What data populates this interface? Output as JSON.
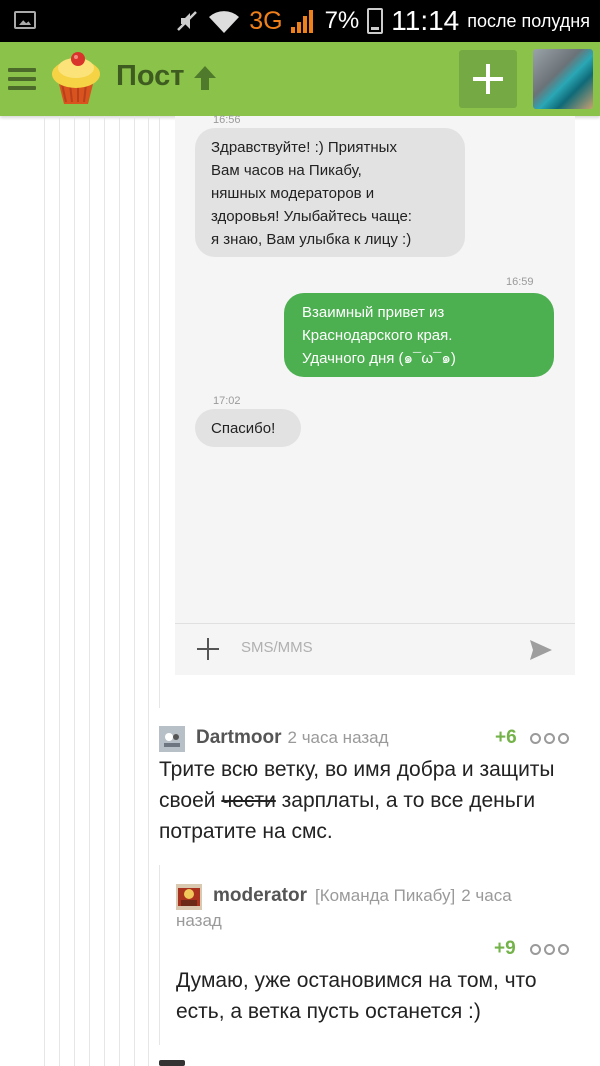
{
  "status_bar": {
    "network": "3G",
    "battery_percent": "7%",
    "time": "11:14",
    "period": "после полудня"
  },
  "app_bar": {
    "title": "Пост",
    "icons": [
      "menu-icon",
      "cupcake-logo-icon",
      "up-arrow-icon",
      "add-icon"
    ]
  },
  "chat_screenshot": {
    "messages": [
      {
        "time": "16:56",
        "direction": "incoming",
        "text": "Здравствуйте! :) Приятных\nВам часов на Пикабу,\nняшных модераторов и\nздоровья! Улыбайтесь чаще:\nя знаю, Вам улыбка к лицу :)"
      },
      {
        "time": "16:59",
        "direction": "outgoing",
        "text": "Взаимный привет из\nКраснодарского края.\nУдачного дня (๑¯ω¯๑)"
      },
      {
        "time": "17:02",
        "direction": "incoming",
        "text": "Спасибо!"
      }
    ],
    "compose_placeholder": "SMS/MMS"
  },
  "comments": [
    {
      "user": "Dartmoor",
      "time": "2 часа назад",
      "rating": "+6",
      "body_before": "Трите всю ветку, во имя добра и защиты своей ",
      "body_struck": "чести",
      "body_after": " зарплаты, а то все деньги потратите на смс."
    },
    {
      "user": "moderator",
      "badge": "[Команда Пикабу]",
      "time_line1": "2 часа",
      "time_line2": "назад",
      "rating": "+9",
      "body": "Думаю, уже остановимся на том, что есть, а ветка пусть останется :)"
    }
  ],
  "colors": {
    "app_bar": "#8bc34a",
    "outgoing_bubble": "#4caf50",
    "incoming_bubble": "#e2e2e2",
    "rating": "#74b24a"
  }
}
